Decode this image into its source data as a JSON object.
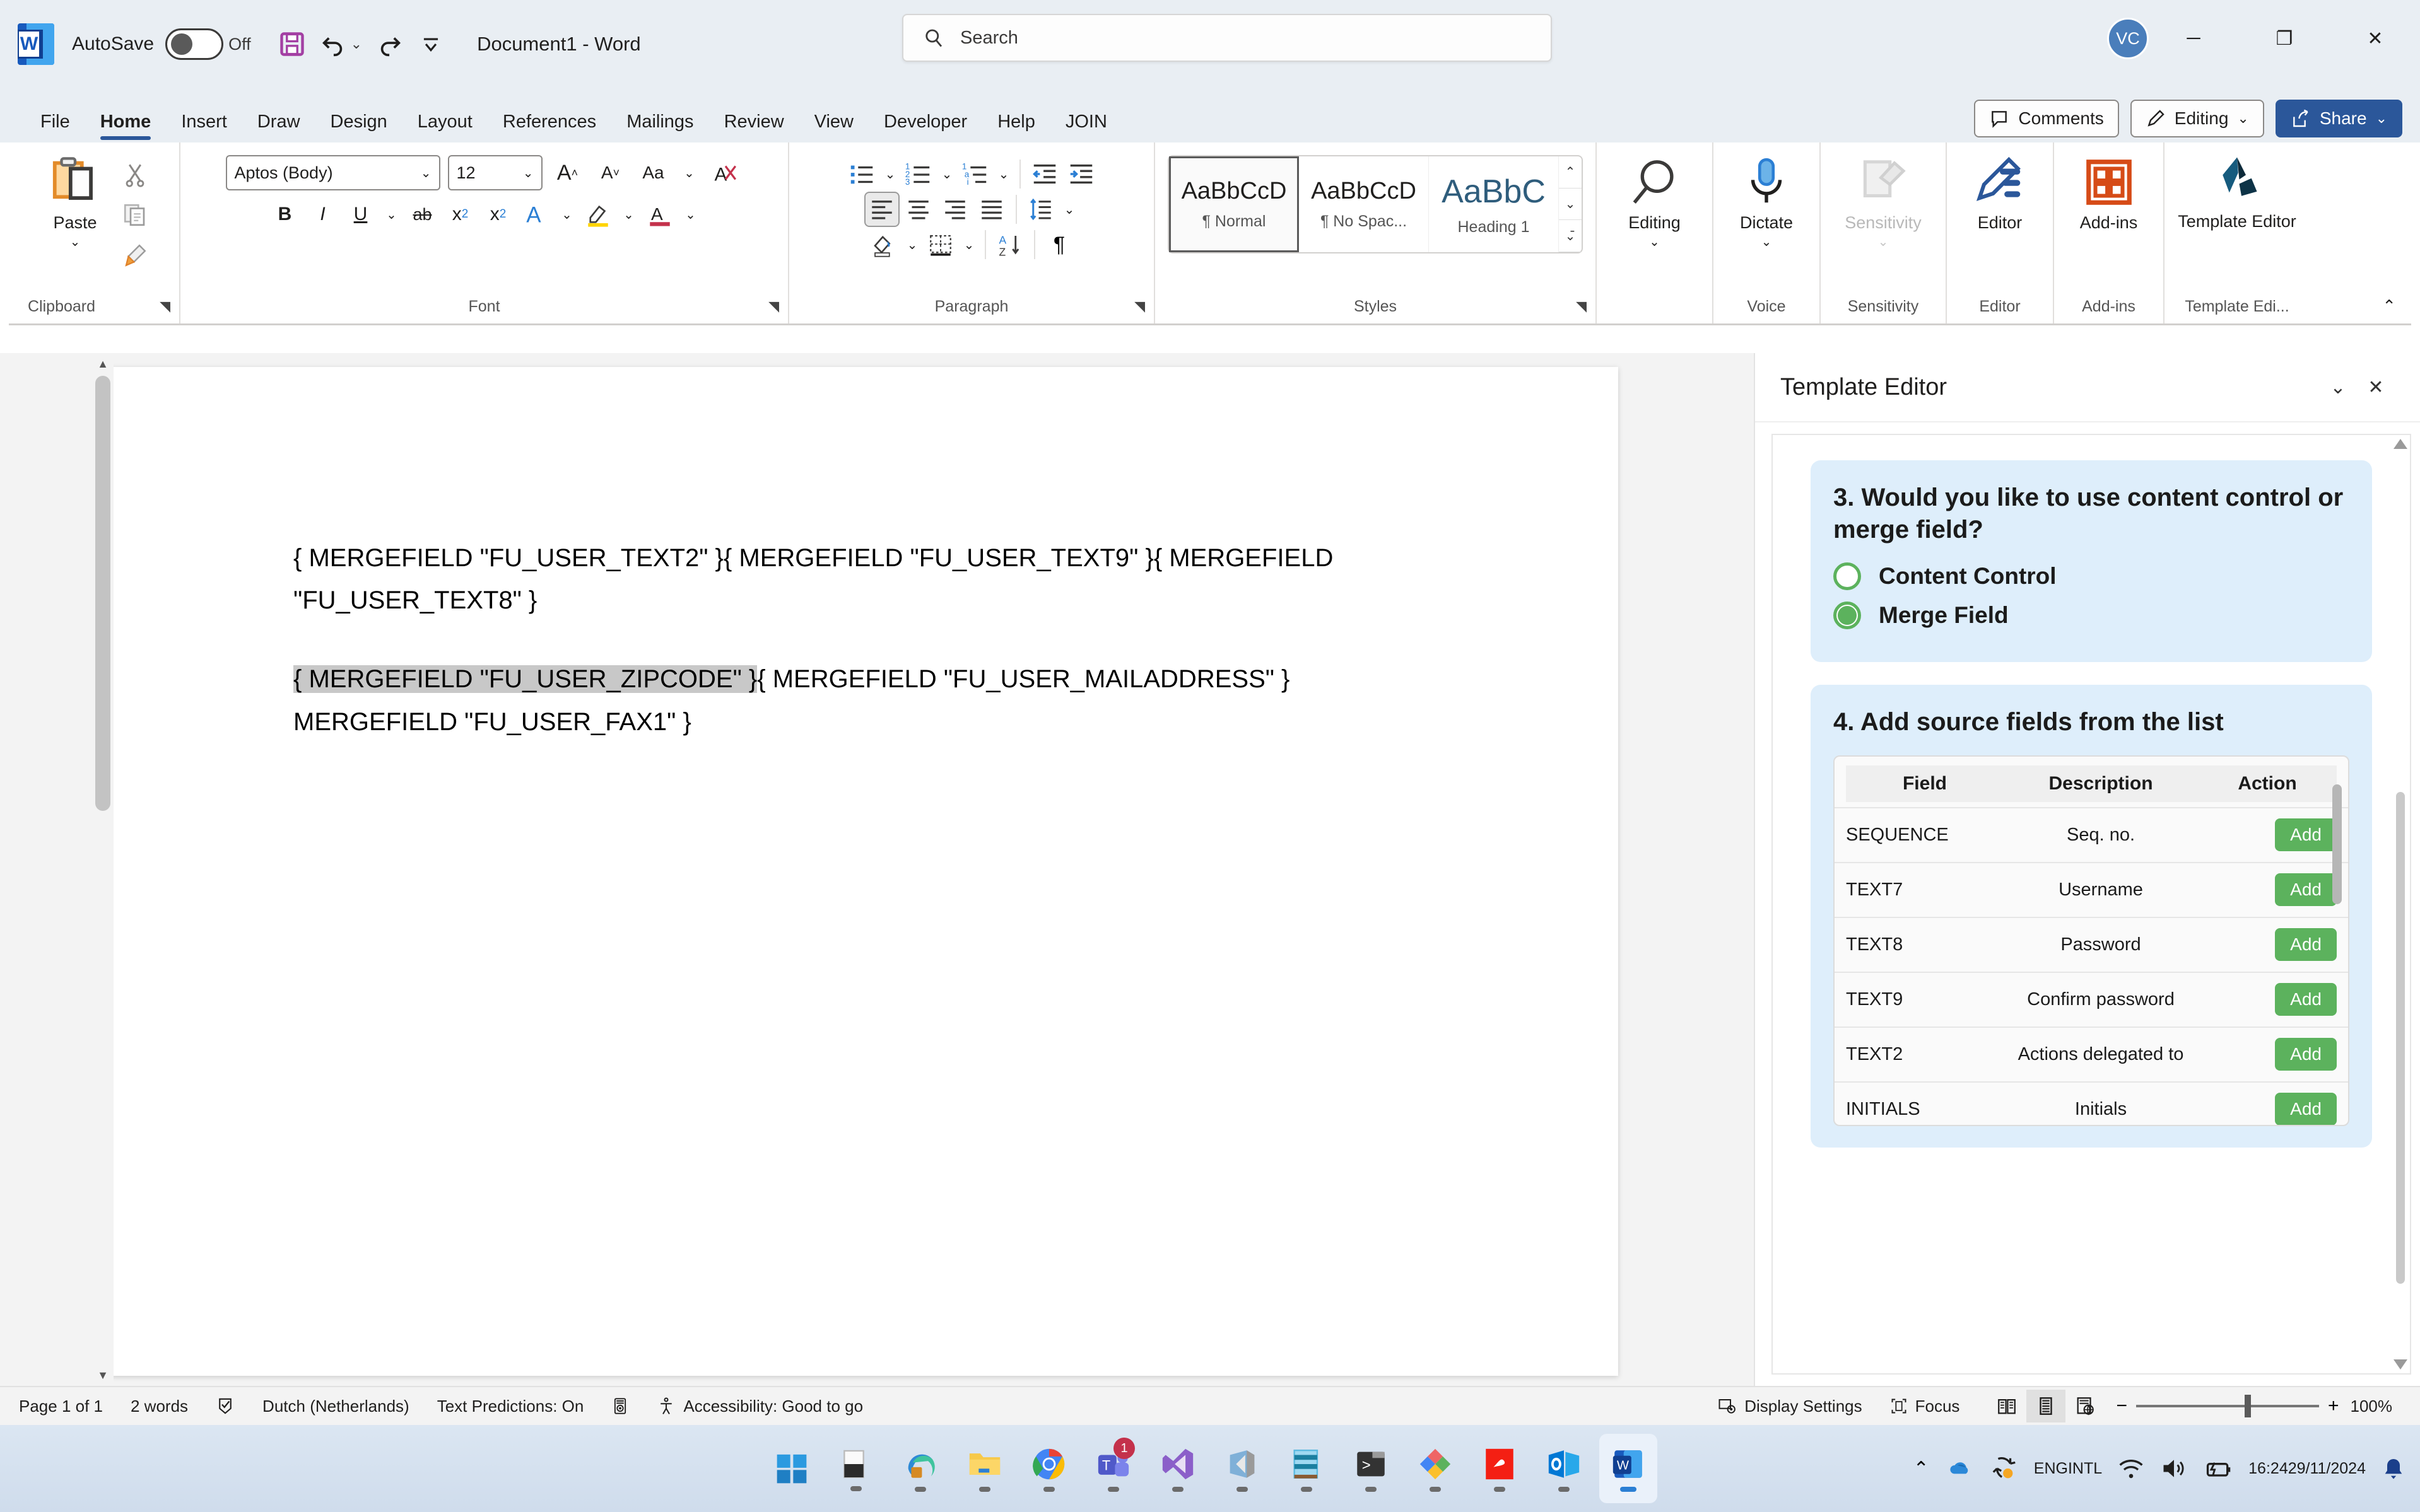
{
  "titlebar": {
    "autosave_label": "AutoSave",
    "autosave_state": "Off",
    "document_title": "Document1  -  Word",
    "avatar_initials": "VC",
    "qat": [
      {
        "name": "save-icon",
        "tip": "Save"
      },
      {
        "name": "undo-icon",
        "tip": "Undo"
      },
      {
        "name": "redo-icon",
        "tip": "Redo"
      },
      {
        "name": "customize-quick-access-toolbar-icon",
        "tip": "Customize Quick Access Toolbar"
      }
    ],
    "window_buttons": [
      "minimize",
      "maximize",
      "close"
    ]
  },
  "search": {
    "placeholder": "Search"
  },
  "tabs": [
    {
      "label": "File",
      "active": false
    },
    {
      "label": "Home",
      "active": true
    },
    {
      "label": "Insert",
      "active": false
    },
    {
      "label": "Draw",
      "active": false
    },
    {
      "label": "Design",
      "active": false
    },
    {
      "label": "Layout",
      "active": false
    },
    {
      "label": "References",
      "active": false
    },
    {
      "label": "Mailings",
      "active": false
    },
    {
      "label": "Review",
      "active": false
    },
    {
      "label": "View",
      "active": false
    },
    {
      "label": "Developer",
      "active": false
    },
    {
      "label": "Help",
      "active": false
    },
    {
      "label": "JOIN",
      "active": false
    }
  ],
  "tab_actions": {
    "comments": "Comments",
    "editing": "Editing",
    "share": "Share"
  },
  "ribbon": {
    "clipboard": {
      "group_label": "Clipboard",
      "paste_label": "Paste",
      "cut": "cut-icon",
      "copy": "copy-icon",
      "format_painter": "format-painter-icon"
    },
    "font": {
      "group_label": "Font",
      "font_name": "Aptos (Body)",
      "font_size": "12",
      "grow_font": "A",
      "shrink_font": "A",
      "change_case": "Aa",
      "clear_formatting": "clear-formatting-icon",
      "bold": "B",
      "italic": "I",
      "underline": "U",
      "strikethrough": "ab",
      "subscript": "x₂",
      "superscript": "x²",
      "text_effects": "A",
      "highlight": "highlight-icon",
      "font_color": "A"
    },
    "paragraph": {
      "group_label": "Paragraph",
      "items": [
        "bullets",
        "numbering",
        "multilevel-list",
        "decrease-indent",
        "increase-indent",
        "align-left",
        "center",
        "align-right",
        "justify",
        "line-spacing",
        "shading",
        "borders",
        "sort",
        "show-formatting-marks"
      ]
    },
    "styles": {
      "group_label": "Styles",
      "gallery": [
        {
          "preview": "AaBbCcD",
          "name": "¶ Normal",
          "selected": true
        },
        {
          "preview": "AaBbCcD",
          "name": "¶ No Spac...",
          "selected": false
        },
        {
          "preview": "AaBbC",
          "name": "Heading 1",
          "selected": false
        }
      ]
    },
    "editing": {
      "group_label": "",
      "label": "Editing"
    },
    "voice": {
      "group_label": "Voice",
      "label": "Dictate"
    },
    "sensitivity": {
      "group_label": "Sensitivity",
      "label": "Sensitivity",
      "disabled": true
    },
    "editor": {
      "group_label": "Editor",
      "label": "Editor"
    },
    "addins": {
      "group_label": "Add-ins",
      "label": "Add-ins"
    },
    "template_editor": {
      "group_label": "Template Edi...",
      "label": "Template Editor"
    }
  },
  "document": {
    "paragraph1_parts": [
      "{ MERGEFIELD \"FU_USER_TEXT2\" }",
      "{ MERGEFIELD \"FU_USER_TEXT9\" }",
      "{ MERGEFIELD \"FU_USER_TEXT8\" }"
    ],
    "paragraph2_parts": [
      "{ MERGEFIELD \"FU_USER_ZIPCODE\" }",
      "{ MERGEFIELD \"FU_USER_MAILADDRESS\" }",
      "{ MERGEFIELD \"FU_USER_FAX1\" }"
    ],
    "paragraph1_line1": "{ MERGEFIELD \"FU_USER_TEXT2\" }{ MERGEFIELD \"FU_USER_TEXT9\" }{ MERGEFIELD",
    "paragraph1_line2": "\"FU_USER_TEXT8\" }",
    "paragraph2_highlight": "{ MERGEFIELD \"FU_USER_ZIPCODE\" }",
    "paragraph2_rest1": "{ MERGEFIELD \"FU_USER_MAILADDRESS\" }",
    "paragraph2_line2": "MERGEFIELD \"FU_USER_FAX1\" }"
  },
  "taskpane": {
    "title": "Template Editor",
    "question3": {
      "heading": "3. Would you like to use content control or merge field?",
      "options": [
        {
          "label": "Content Control",
          "selected": false
        },
        {
          "label": "Merge Field",
          "selected": true
        }
      ]
    },
    "question4": {
      "heading": "4. Add source fields from the list",
      "columns": [
        "Field",
        "Description",
        "Action"
      ],
      "action_label": "Add",
      "rows": [
        {
          "field": "SEQUENCE",
          "description": "Seq. no.",
          "action": "Add"
        },
        {
          "field": "TEXT7",
          "description": "Username",
          "action": "Add"
        },
        {
          "field": "TEXT8",
          "description": "Password",
          "action": "Add"
        },
        {
          "field": "TEXT9",
          "description": "Confirm password",
          "action": "Add"
        },
        {
          "field": "TEXT2",
          "description": "Actions delegated to",
          "action": "Add"
        },
        {
          "field": "INITIALS",
          "description": "Initials",
          "action": "Add"
        }
      ]
    }
  },
  "statusbar": {
    "page": "Page 1 of 1",
    "words": "2 words",
    "proofing_icon": "proofing-icon",
    "language": "Dutch (Netherlands)",
    "text_predictions": "Text Predictions: On",
    "focus_mode_icon": "text-prediction-icon",
    "accessibility": "Accessibility: Good to go",
    "display_settings": "Display Settings",
    "focus": "Focus",
    "zoom_level": "100%",
    "zoom_out": "−",
    "zoom_in": "+",
    "views": [
      "read-mode",
      "print-layout",
      "web-layout"
    ]
  },
  "taskbar": {
    "items": [
      {
        "name": "start-button"
      },
      {
        "name": "task-view-button"
      },
      {
        "name": "microsoft-edge-icon"
      },
      {
        "name": "file-explorer-icon"
      },
      {
        "name": "google-chrome-icon"
      },
      {
        "name": "microsoft-teams-icon",
        "badge": "1"
      },
      {
        "name": "visual-studio-icon"
      },
      {
        "name": "visual-studio-code-icon"
      },
      {
        "name": "notepad-icon"
      },
      {
        "name": "windows-terminal-icon"
      },
      {
        "name": "app-icon"
      },
      {
        "name": "pdf-reader-icon"
      },
      {
        "name": "microsoft-outlook-icon"
      },
      {
        "name": "microsoft-word-icon",
        "active": true
      }
    ],
    "tray": {
      "language_line1": "ENG",
      "language_line2": "INTL",
      "time": "16:24",
      "date": "29/11/2024"
    }
  },
  "colors": {
    "accent_blue": "#2b579a",
    "card_blue": "#deeefb",
    "green": "#5cb25d",
    "titlebar_bg": "#e9eef3"
  }
}
